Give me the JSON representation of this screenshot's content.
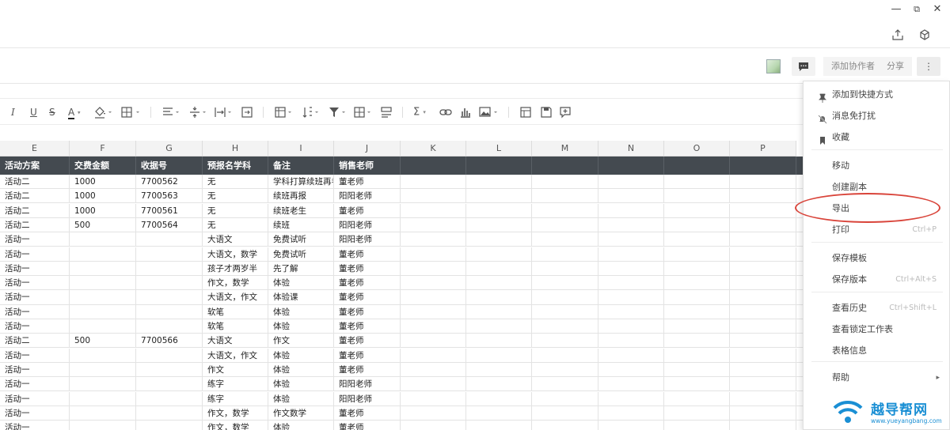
{
  "window_controls": {
    "minimize": "—",
    "restore": "⧉",
    "close": "✕"
  },
  "header": {
    "add_collaborator": "添加协作者",
    "share": "分享",
    "more": "⋮"
  },
  "sheet": {
    "columns": [
      "E",
      "F",
      "G",
      "H",
      "I",
      "J",
      "K",
      "L",
      "M",
      "N",
      "O",
      "P"
    ],
    "headers": [
      "活动方案",
      "交费金额",
      "收据号",
      "预报名学科",
      "备注",
      "销售老师"
    ],
    "rows": [
      [
        "活动二",
        "1000",
        "7700562",
        "无",
        "学科打算续班再考虑",
        "董老师"
      ],
      [
        "活动二",
        "1000",
        "7700563",
        "无",
        "续班再报",
        "阳阳老师"
      ],
      [
        "活动二",
        "1000",
        "7700561",
        "无",
        "续班老生",
        "董老师"
      ],
      [
        "活动二",
        "500",
        "7700564",
        "无",
        "续班",
        "阳阳老师"
      ],
      [
        "活动一",
        "",
        "",
        "大语文",
        "免费试听",
        "阳阳老师"
      ],
      [
        "活动一",
        "",
        "",
        "大语文，数学",
        "免费试听",
        "董老师"
      ],
      [
        "活动一",
        "",
        "",
        "孩子才两岁半",
        "先了解",
        "董老师"
      ],
      [
        "活动一",
        "",
        "",
        "作文，数学",
        "体验",
        "董老师"
      ],
      [
        "活动一",
        "",
        "",
        "大语文，作文",
        "体验课",
        "董老师"
      ],
      [
        "活动一",
        "",
        "",
        "软笔",
        "体验",
        "董老师"
      ],
      [
        "活动一",
        "",
        "",
        "软笔",
        "体验",
        "董老师"
      ],
      [
        "活动二",
        "500",
        "7700566",
        "大语文",
        "作文",
        "董老师"
      ],
      [
        "活动一",
        "",
        "",
        "大语文，作文",
        "体验",
        "董老师"
      ],
      [
        "活动一",
        "",
        "",
        "作文",
        "体验",
        "董老师"
      ],
      [
        "活动一",
        "",
        "",
        "练字",
        "体验",
        "阳阳老师"
      ],
      [
        "活动一",
        "",
        "",
        "练字",
        "体验",
        "阳阳老师"
      ],
      [
        "活动一",
        "",
        "",
        "作文，数学",
        "作文数学",
        "董老师"
      ],
      [
        "活动一",
        "",
        "",
        "作文，数学",
        "体验",
        "董老师"
      ]
    ]
  },
  "menu": {
    "items": [
      {
        "label": "添加到快捷方式",
        "icon": "pin-icon"
      },
      {
        "label": "消息免打扰",
        "icon": "bell-off-icon"
      },
      {
        "label": "收藏",
        "icon": "bookmark-icon"
      },
      {
        "label": "移动"
      },
      {
        "label": "创建副本"
      },
      {
        "label": "导出"
      },
      {
        "label": "打印",
        "shortcut": "Ctrl+P"
      },
      {
        "label": "保存模板"
      },
      {
        "label": "保存版本",
        "shortcut": "Ctrl+Alt+S"
      },
      {
        "label": "查看历史",
        "shortcut": "Ctrl+Shift+L"
      },
      {
        "label": "查看锁定工作表"
      },
      {
        "label": "表格信息"
      },
      {
        "label": "帮助",
        "arrow": "▸"
      }
    ]
  },
  "watermark": {
    "title": "越导帮网",
    "url": "www.yueyangbang.com"
  },
  "colors": {
    "header_dark": "#444a50",
    "highlight": "#d9443a",
    "watermark": "#1a8fd4"
  }
}
